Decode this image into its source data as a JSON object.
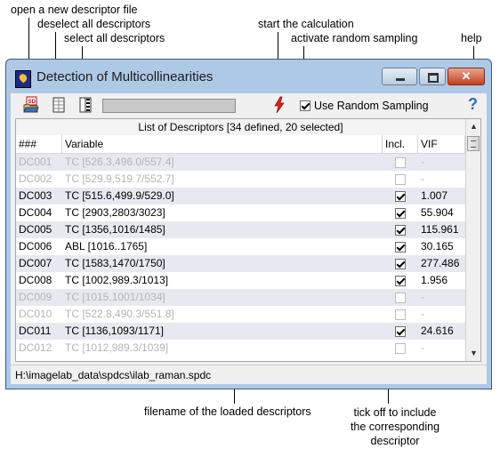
{
  "annotations": {
    "open_file": "open a new descriptor file",
    "deselect_all": "deselect all descriptors",
    "select_all": "select all descriptors",
    "start_calc": "start the calculation",
    "random_sampling": "activate random sampling",
    "help": "help",
    "filename": "filename of the loaded descriptors",
    "tick_off_1": "tick off to include",
    "tick_off_2": "the corresponding",
    "tick_off_3": "descriptor"
  },
  "window": {
    "title": "Detection of Multicollinearities",
    "close_glyph": "✕"
  },
  "toolbar": {
    "random_sampling_label": "Use Random Sampling",
    "random_sampling_checked": true,
    "help_glyph": "?",
    "icons": [
      "open-file-icon",
      "deselect-all-icon",
      "select-all-icon",
      "lightning-icon",
      "help-icon"
    ]
  },
  "list": {
    "header": "List of Descriptors [34 defined, 20 selected]",
    "columns": [
      "###",
      "Variable",
      "Incl.",
      "VIF"
    ],
    "rows": [
      {
        "id": "DC001",
        "variable": "TC [526.3,496.0/557.4]",
        "included": false,
        "vif": "-"
      },
      {
        "id": "DC002",
        "variable": "TC [529.9,519.7/552.7]",
        "included": false,
        "vif": "-"
      },
      {
        "id": "DC003",
        "variable": "TC [515.6,499.9/529.0]",
        "included": true,
        "vif": "1.007"
      },
      {
        "id": "DC004",
        "variable": "TC [2903,2803/3023]",
        "included": true,
        "vif": "55.904"
      },
      {
        "id": "DC005",
        "variable": "TC [1356,1016/1485]",
        "included": true,
        "vif": "115.961"
      },
      {
        "id": "DC006",
        "variable": "ABL [1016..1765]",
        "included": true,
        "vif": "30.165"
      },
      {
        "id": "DC007",
        "variable": "TC [1583,1470/1750]",
        "included": true,
        "vif": "277.486"
      },
      {
        "id": "DC008",
        "variable": "TC [1002,989.3/1013]",
        "included": true,
        "vif": "1.956"
      },
      {
        "id": "DC009",
        "variable": "TC [1015,1001/1034]",
        "included": false,
        "vif": "-"
      },
      {
        "id": "DC010",
        "variable": "TC [522.8,490.3/551.8]",
        "included": false,
        "vif": "-"
      },
      {
        "id": "DC011",
        "variable": "TC [1136,1093/1171]",
        "included": true,
        "vif": "24.616"
      },
      {
        "id": "DC012",
        "variable": "TC [1012,989.3/1039]",
        "included": false,
        "vif": "-"
      }
    ]
  },
  "status": {
    "path": "H:\\imagelab_data\\spdcs\\ilab_raman.spdc"
  }
}
